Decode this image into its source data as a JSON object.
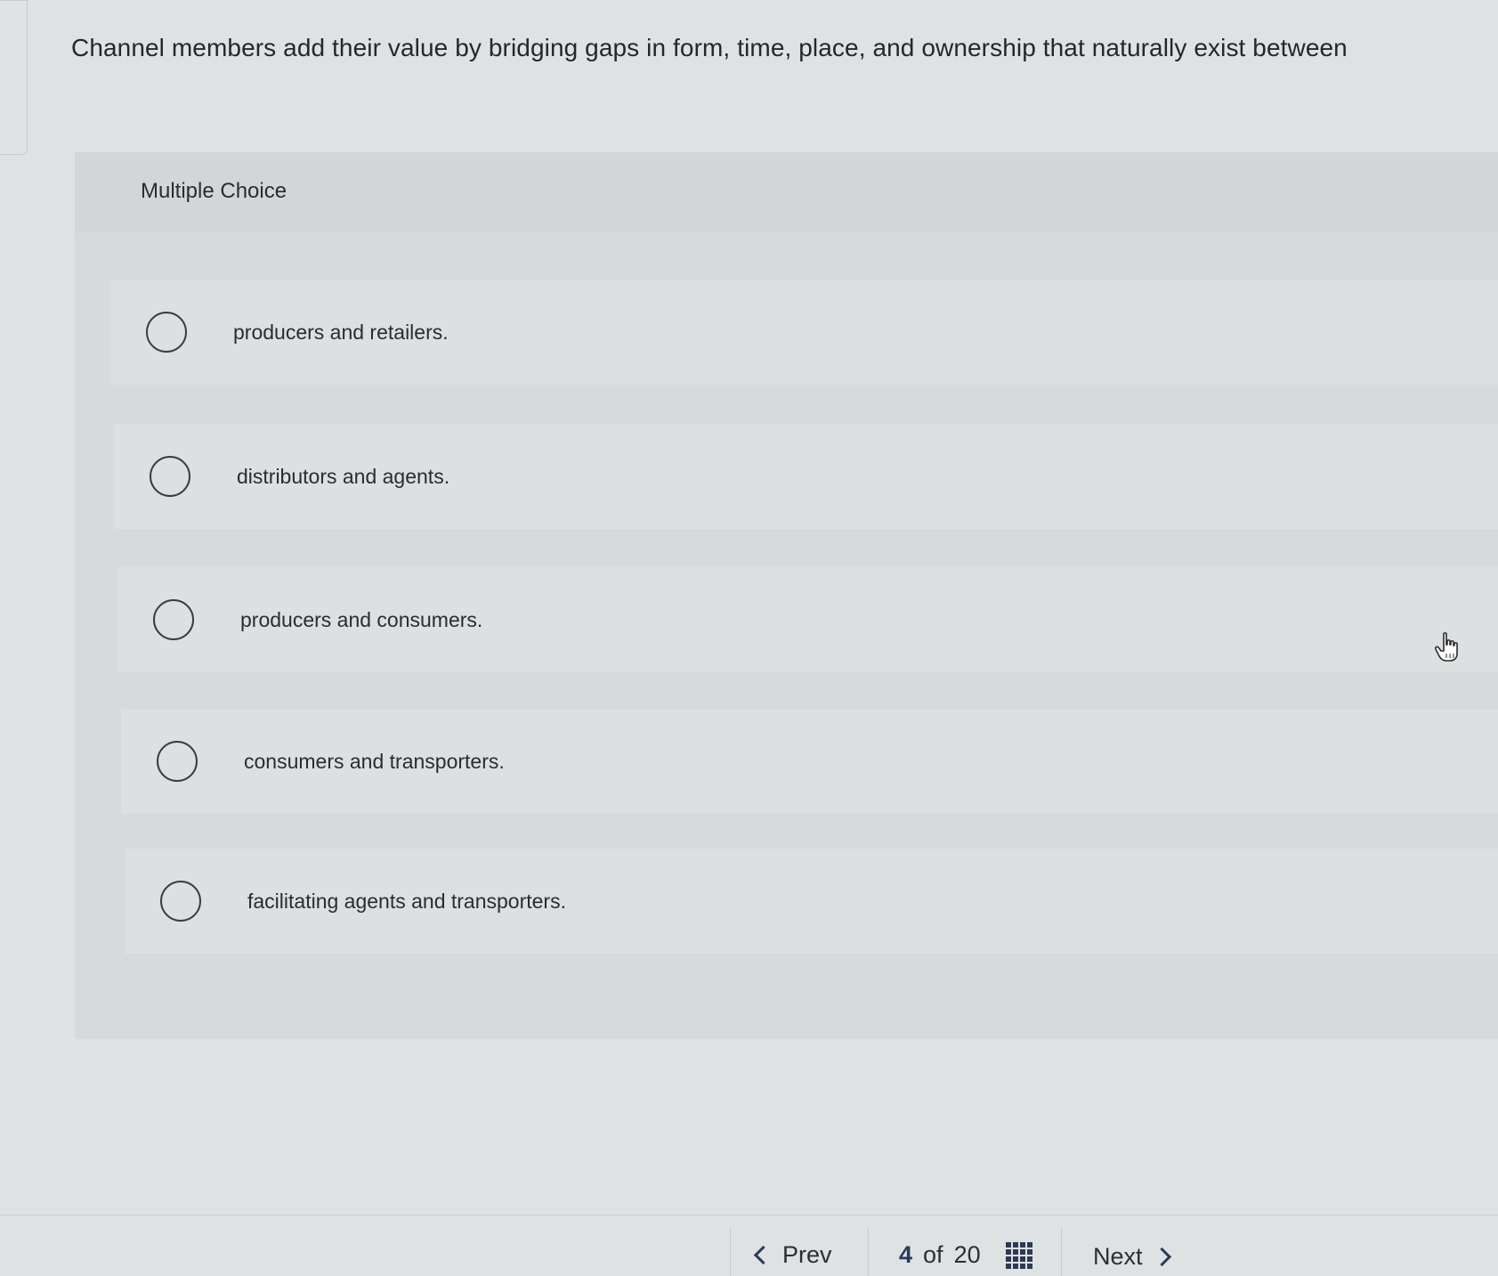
{
  "question": {
    "text": "Channel members add their value by bridging gaps in form, time, place, and ownership that naturally exist between"
  },
  "panel": {
    "label": "Multiple Choice"
  },
  "options": [
    {
      "label": "producers and retailers."
    },
    {
      "label": "distributors and agents."
    },
    {
      "label": "producers and consumers."
    },
    {
      "label": "consumers and transporters."
    },
    {
      "label": "facilitating agents and transporters."
    }
  ],
  "nav": {
    "prev_label": "Prev",
    "current_page": "4",
    "of_label": "of",
    "total_pages": "20",
    "next_label": "Next",
    "prev_icon": "chevron-left-icon",
    "next_icon": "chevron-right-icon",
    "grid_icon": "question-grid-icon"
  },
  "colors": {
    "background": "#dfe2e3",
    "panel": "#d7dadc",
    "option_row": "#dde0e1",
    "nav_accent": "#2c3a55"
  }
}
